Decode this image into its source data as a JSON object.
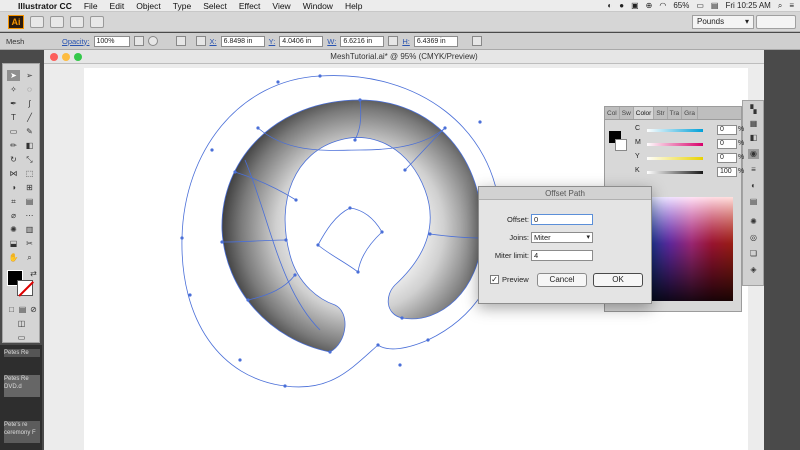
{
  "menubar": {
    "apple": "",
    "app_name": "Illustrator CC",
    "items": [
      "File",
      "Edit",
      "Object",
      "Type",
      "Select",
      "Effect",
      "View",
      "Window",
      "Help"
    ],
    "battery": "65%",
    "clock": "Fri 10:25 AM"
  },
  "appbar": {
    "logo": "Ai",
    "workspace": "Pounds"
  },
  "controlbar": {
    "selection_label": "Mesh",
    "opacity_label": "Opacity:",
    "opacity_value": "100%",
    "x_label": "X:",
    "x_value": "6.8498 in",
    "y_label": "Y:",
    "y_value": "4.0406 in",
    "w_label": "W:",
    "w_value": "6.6216 in",
    "h_label": "H:",
    "h_value": "6.4369 in"
  },
  "document": {
    "title": "MeshTutorial.ai* @ 95% (CMYK/Preview)"
  },
  "color_panel": {
    "tabs": [
      "Col",
      "Sw",
      "Color",
      "Str",
      "Tra",
      "Gra"
    ],
    "active_tab": "Color",
    "channels": [
      {
        "name": "C",
        "value": "0",
        "color": "#00a0d8"
      },
      {
        "name": "M",
        "value": "0",
        "color": "#d8006a"
      },
      {
        "name": "Y",
        "value": "0",
        "color": "#e8d200"
      },
      {
        "name": "K",
        "value": "100",
        "color": "#1a1a1a"
      }
    ],
    "pct": "%"
  },
  "dialog": {
    "title": "Offset Path",
    "offset_label": "Offset:",
    "offset_value": "0",
    "joins_label": "Joins:",
    "joins_value": "Miter",
    "miter_label": "Miter limit:",
    "miter_value": "4",
    "preview_label": "Preview",
    "cancel_label": "Cancel",
    "ok_label": "OK"
  },
  "thumbs": [
    "Petes Re",
    "Petes Re DVD.d",
    "Pete's re ceremony F"
  ]
}
